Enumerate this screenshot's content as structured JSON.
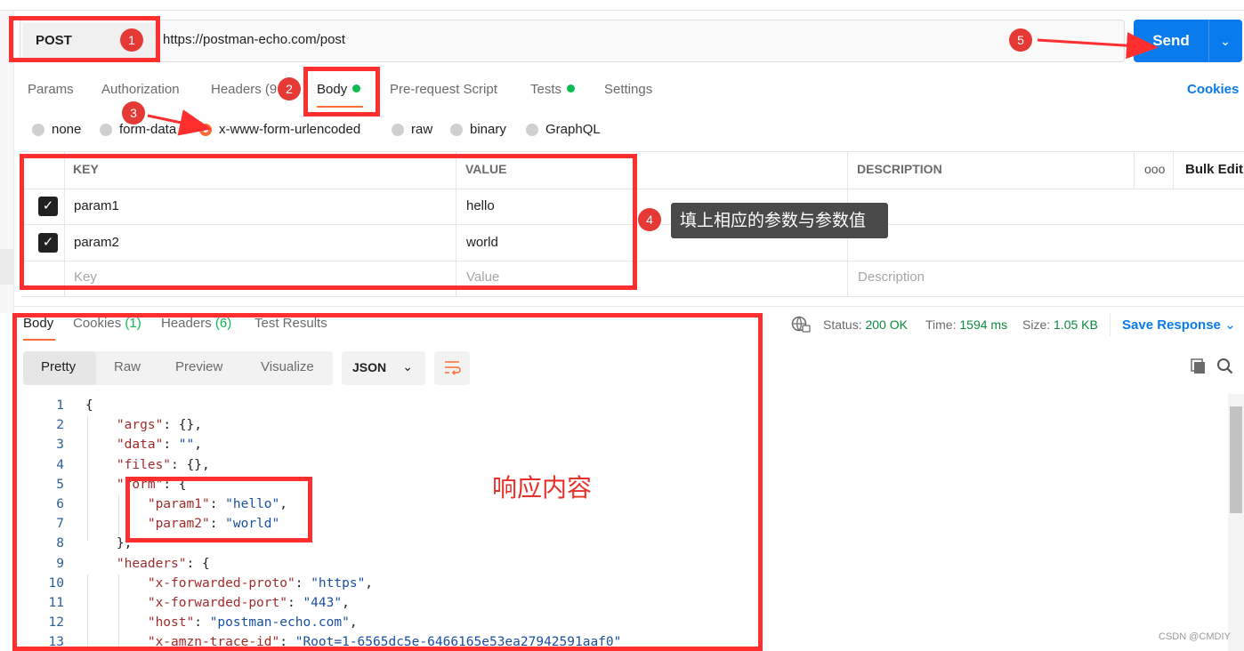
{
  "request": {
    "method": "POST",
    "url": "https://postman-echo.com/post",
    "send_label": "Send"
  },
  "request_tabs": [
    {
      "label": "Params"
    },
    {
      "label": "Authorization"
    },
    {
      "label": "Headers (9"
    },
    {
      "label": "Body"
    },
    {
      "label": "Pre-request Script"
    },
    {
      "label": "Tests"
    },
    {
      "label": "Settings"
    }
  ],
  "cookies_label": "Cookies",
  "body_types": [
    "none",
    "form-data",
    "x-www-form-urlencoded",
    "raw",
    "binary",
    "GraphQL"
  ],
  "body_type_selected": "x-www-form-urlencoded",
  "params_table": {
    "headers": {
      "key": "KEY",
      "value": "VALUE",
      "description": "DESCRIPTION",
      "more": "ooo",
      "bulk": "Bulk Edit"
    },
    "rows": [
      {
        "key": "param1",
        "value": "hello",
        "checked": true
      },
      {
        "key": "param2",
        "value": "world",
        "checked": true
      }
    ],
    "placeholder": {
      "key": "Key",
      "value": "Value",
      "description": "Description"
    }
  },
  "response": {
    "tabs": [
      {
        "label": "Body"
      },
      {
        "label": "Cookies",
        "count": "(1)"
      },
      {
        "label": "Headers",
        "count": "(6)"
      },
      {
        "label": "Test Results"
      }
    ],
    "status_label": "Status:",
    "status_value": "200 OK",
    "time_label": "Time:",
    "time_value": "1594 ms",
    "size_label": "Size:",
    "size_value": "1.05 KB",
    "save_label": "Save Response",
    "views": [
      "Pretty",
      "Raw",
      "Preview",
      "Visualize"
    ],
    "format": "JSON",
    "code_lines": [
      {
        "n": "1",
        "text": "{"
      },
      {
        "n": "2",
        "text": "    \"args\": {},"
      },
      {
        "n": "3",
        "text": "    \"data\": \"\","
      },
      {
        "n": "4",
        "text": "    \"files\": {},"
      },
      {
        "n": "5",
        "text": "    \"form\": {"
      },
      {
        "n": "6",
        "text": "        \"param1\": \"hello\","
      },
      {
        "n": "7",
        "text": "        \"param2\": \"world\""
      },
      {
        "n": "8",
        "text": "    },"
      },
      {
        "n": "9",
        "text": "    \"headers\": {"
      },
      {
        "n": "10",
        "text": "        \"x-forwarded-proto\": \"https\","
      },
      {
        "n": "11",
        "text": "        \"x-forwarded-port\": \"443\","
      },
      {
        "n": "12",
        "text": "        \"host\": \"postman-echo.com\","
      },
      {
        "n": "13",
        "text": "        \"x-amzn-trace-id\": \"Root=1-6565dc5e-6466165e53ea27942591aaf0\""
      }
    ]
  },
  "annotations": {
    "badges": [
      "1",
      "2",
      "3",
      "4",
      "5"
    ],
    "tip_text": "填上相应的参数与参数值",
    "response_note": "响应内容",
    "watermark": "CSDN @CMDIY",
    "color": "#ff2f2f"
  }
}
